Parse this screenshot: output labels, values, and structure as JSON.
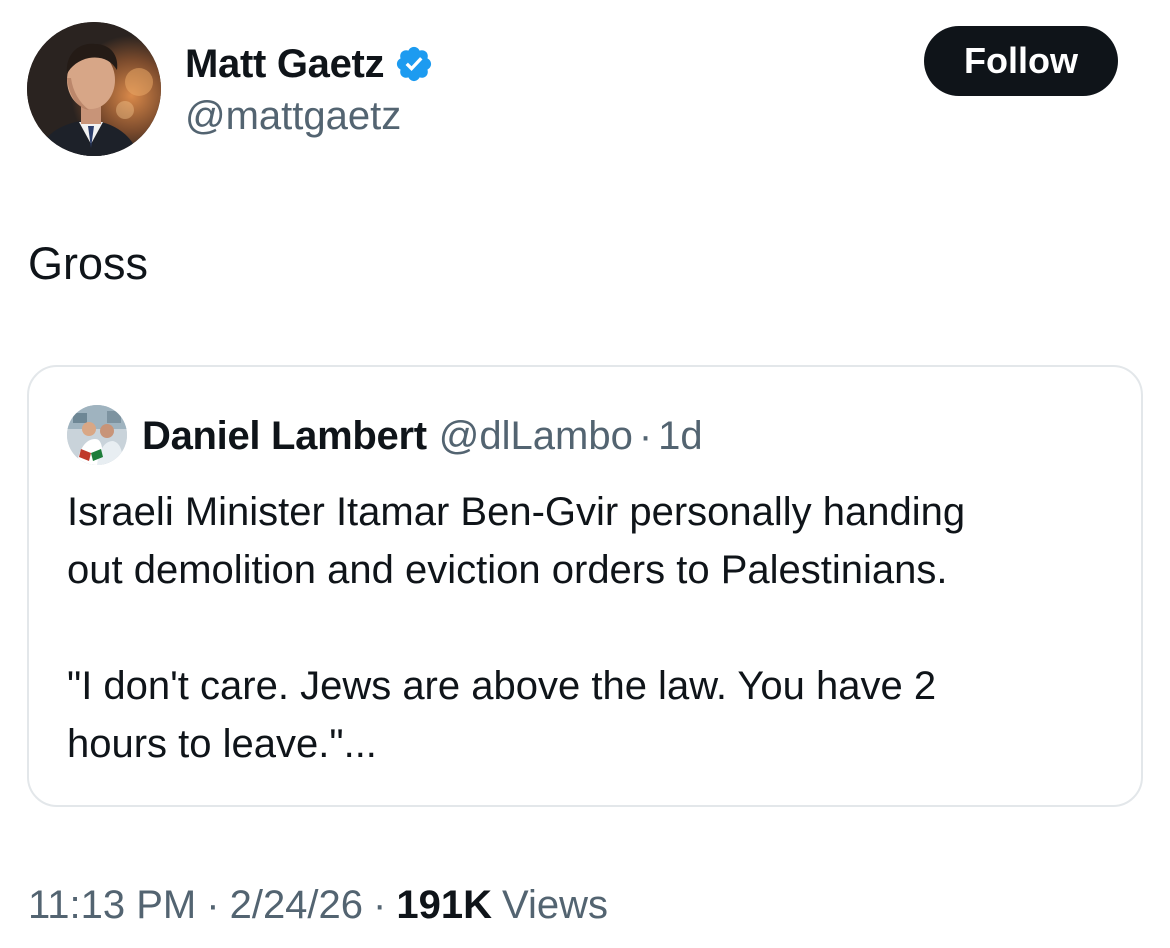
{
  "author": {
    "name": "Matt Gaetz",
    "handle": "@mattgaetz",
    "verified": true
  },
  "follow_label": "Follow",
  "tweet_text": "Gross",
  "quoted_tweet": {
    "author_name": "Daniel Lambert",
    "author_handle": "@dlLambo",
    "separator": "·",
    "time_ago": "1d",
    "text_lines": [
      "Israeli Minister Itamar Ben-Gvir personally handing",
      "out demolition and eviction orders to Palestinians.",
      "",
      "\"I don't care. Jews are above the law. You have 2",
      "hours to leave.\"..."
    ]
  },
  "meta": {
    "time": "11:13 PM",
    "separator": "·",
    "date": "2/24/26",
    "views_count": "191K",
    "views_label": "Views"
  },
  "colors": {
    "text_primary": "#0f1419",
    "text_secondary": "#536471",
    "verified_blue": "#1d9bf0",
    "follow_button_bg": "#0f1419",
    "card_border": "#e3e7ea"
  },
  "icons": {
    "verified": "verified-badge-icon"
  }
}
